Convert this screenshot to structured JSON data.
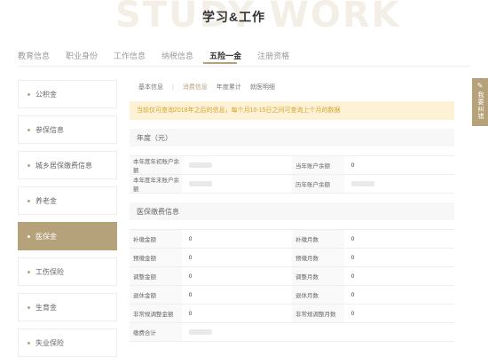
{
  "page": {
    "background_word": "STUDY WORK",
    "title": "学习&工作"
  },
  "colors": {
    "accent": "#b5a27a",
    "notice_bg": "#fdf2d6",
    "notice_text": "#d9a12e"
  },
  "topnav": [
    "教育信息",
    "职业身份",
    "工作信息",
    "纳税信息",
    "五险一金",
    "注册资格"
  ],
  "sidebar": [
    "公积金",
    "参保信息",
    "城乡居保缴费信息",
    "养老金",
    "医保金",
    "工伤保险",
    "生育金",
    "失业保险"
  ],
  "subtabs": [
    "基本信息",
    "消费信息",
    "年度累计",
    "就医明细"
  ],
  "notice": "当前仅可查询2018年之后的信息，每个月10-15日之间可查询上个月的数据",
  "year_section": "年度（元）",
  "year_rows": [
    {
      "l1": "本年度年初账户余额",
      "v1": "",
      "l2": "当年账户余额",
      "v2": "0"
    },
    {
      "l1": "本年度年末账户余额",
      "v1": "",
      "l2": "历年账户余额",
      "v2": ""
    }
  ],
  "pay_section": "医保缴费信息",
  "pay_rows": [
    {
      "l1": "补缴金额",
      "v1": "0",
      "l2": "补缴月数",
      "v2": "0"
    },
    {
      "l1": "预缴金额",
      "v1": "0",
      "l2": "预缴月数",
      "v2": "0"
    },
    {
      "l1": "调整金额",
      "v1": "0",
      "l2": "调整月数",
      "v2": "0"
    },
    {
      "l1": "退休金额",
      "v1": "0",
      "l2": "退休月数",
      "v2": "0"
    },
    {
      "l1": "非常规调整金额",
      "v1": "0",
      "l2": "非常规调整月数",
      "v2": "0"
    },
    {
      "l1": "缴费合计",
      "v1": ""
    }
  ],
  "float_button": "我要纠错"
}
